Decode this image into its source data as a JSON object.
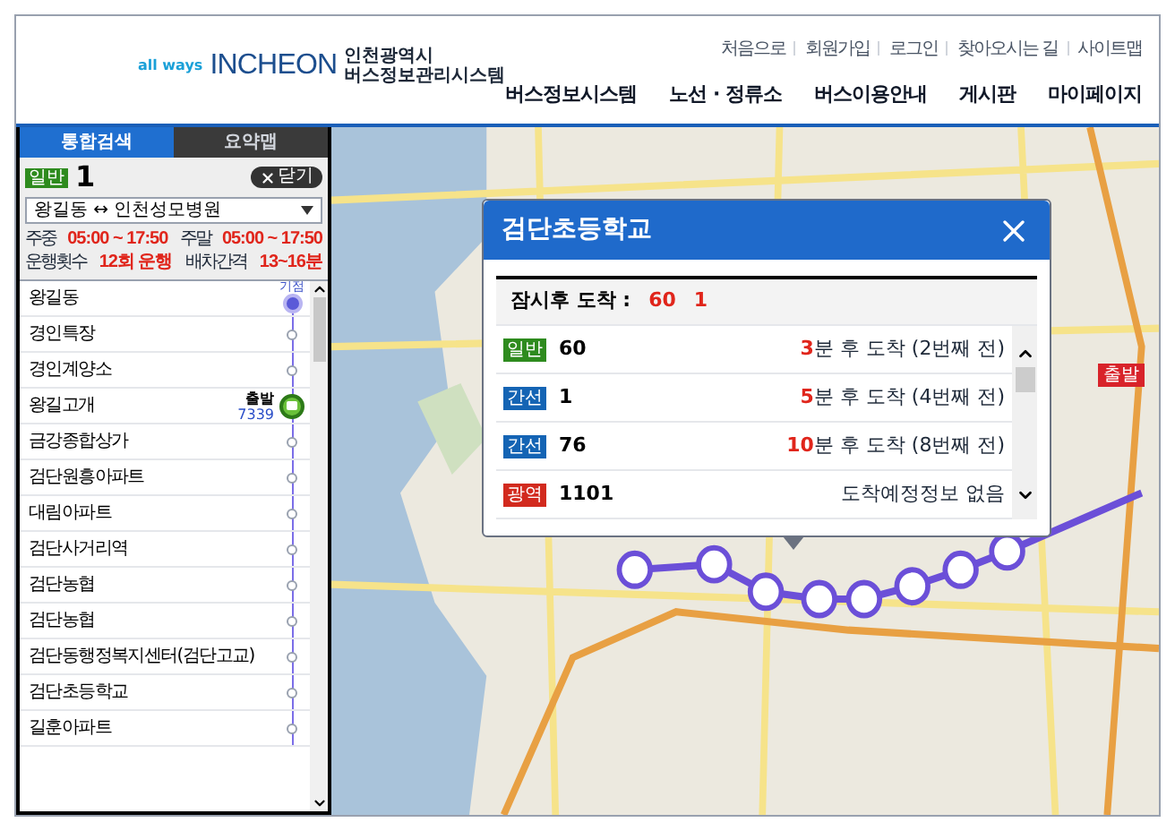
{
  "header": {
    "logo_tagline": "all ways",
    "logo_name": "INCHEON",
    "system_name_lines": [
      "인천광역시",
      "버스정보관리시스템"
    ],
    "top_links": [
      "처음으로",
      "회원가입",
      "로그인",
      "찾아오시는 길",
      "사이트맵"
    ],
    "nav": [
      "버스정보시스템",
      "노선 · 정류소",
      "버스이용안내",
      "게시판",
      "마이페이지"
    ]
  },
  "side_tabs": [
    {
      "label": "통합검색",
      "selected": true
    },
    {
      "label": "요약맵",
      "selected": false
    }
  ],
  "route": {
    "type_label": "일반",
    "number": "1",
    "close_label": "닫기",
    "direction": "왕길동 ↔ 인천성모병원",
    "schedule": [
      {
        "label": "주중",
        "value": "05:00 ~ 17:50"
      },
      {
        "label": "주말",
        "value": "05:00 ~ 17:50"
      },
      {
        "label": "운행횟수",
        "value": "12회 운행"
      },
      {
        "label": "배차간격",
        "value": "13~16분"
      }
    ]
  },
  "stops": [
    {
      "name": "왕길동",
      "start_label": "기점"
    },
    {
      "name": "경인특장"
    },
    {
      "name": "경인계양소"
    },
    {
      "name": "왕길고개",
      "bus_status": "출발",
      "bus_plate": "7339"
    },
    {
      "name": "금강종합상가"
    },
    {
      "name": "검단원흥아파트"
    },
    {
      "name": "대림아파트"
    },
    {
      "name": "검단사거리역"
    },
    {
      "name": "검단농협"
    },
    {
      "name": "검단농협"
    },
    {
      "name": "검단동행정복지센터(검단고교)"
    },
    {
      "name": "검단초등학교"
    },
    {
      "name": "길훈아파트"
    }
  ],
  "map": {
    "flag_label": "출발"
  },
  "popup": {
    "title": "검단초등학교",
    "soon_label": "잠시후 도착 :",
    "soon_routes": [
      "60",
      "1"
    ],
    "arrivals": [
      {
        "kind": "general",
        "type_label": "일반",
        "route": "60",
        "minutes": "3",
        "info": "분 후 도착 (2번째 전)"
      },
      {
        "kind": "trunk",
        "type_label": "간선",
        "route": "1",
        "minutes": "5",
        "info": "분 후 도착 (4번째 전)"
      },
      {
        "kind": "trunk",
        "type_label": "간선",
        "route": "76",
        "minutes": "10",
        "info": "분 후 도착 (8번째 전)"
      },
      {
        "kind": "express",
        "type_label": "광역",
        "route": "1101",
        "info": "도착예정정보 없음"
      }
    ]
  }
}
